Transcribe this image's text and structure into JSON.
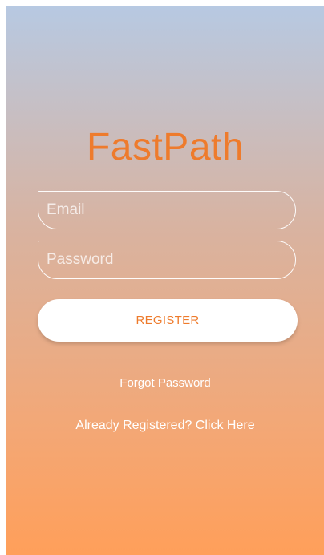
{
  "app": {
    "title": "FastPath"
  },
  "form": {
    "email_placeholder": "Email",
    "email_value": "",
    "password_placeholder": "Password",
    "password_value": "",
    "register_label": "REGISTER"
  },
  "links": {
    "forgot_password": "Forgot Password",
    "already_registered": "Already Registered? Click Here"
  },
  "colors": {
    "accent": "#ee7b2c",
    "gradient_top": "#b7c9e2",
    "gradient_bottom": "#ff9f5a"
  }
}
